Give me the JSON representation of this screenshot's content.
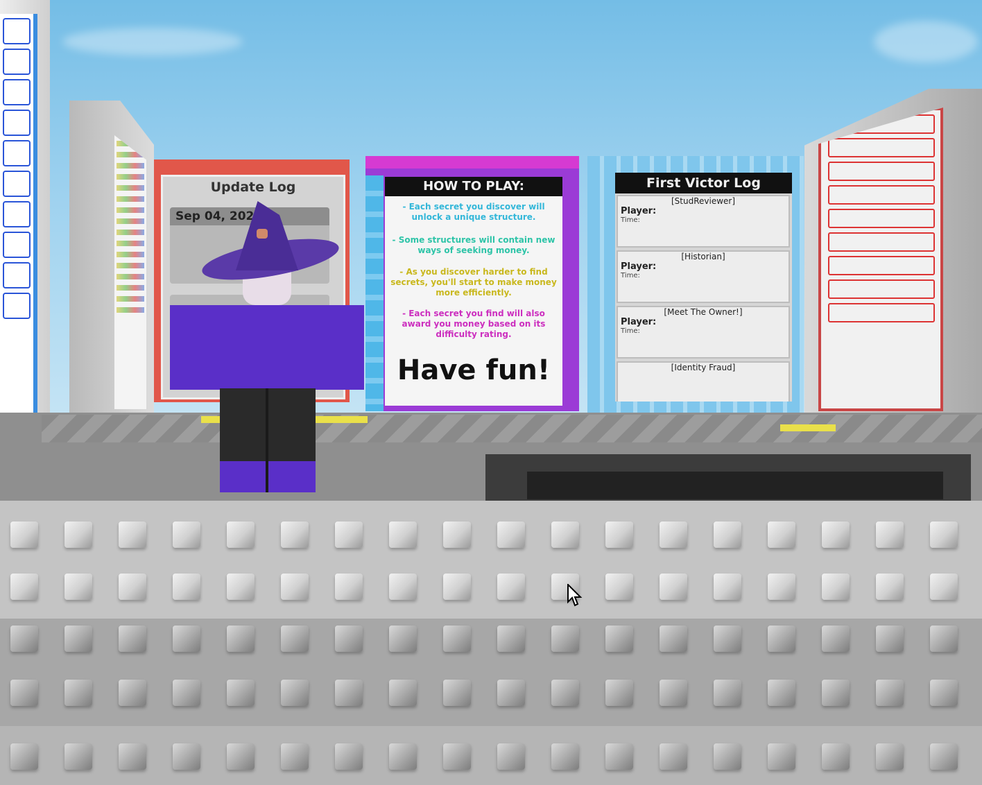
{
  "update_log": {
    "title": "Update Log",
    "date": "Sep 04, 2025"
  },
  "how_to_play": {
    "title": "HOW TO PLAY:",
    "rules": [
      {
        "text": "- Each secret you discover will unlock a unique structure.",
        "color": "#33b7d9"
      },
      {
        "text": "- Some structures will contain new ways of seeking money.",
        "color": "#2ec4a8"
      },
      {
        "text": "- As you discover harder to find secrets, you'll start to make money more efficiently.",
        "color": "#c9b81e"
      },
      {
        "text": "- Each secret you find will also award you money based on its difficulty rating.",
        "color": "#cc2fbf"
      }
    ],
    "closing": "Have fun!"
  },
  "first_victor_log": {
    "title": "First Victor Log",
    "records": [
      {
        "badge": "[StudReviewer]",
        "player_label": "Player:",
        "player": "",
        "time_label": "Time:"
      },
      {
        "badge": "[Historian]",
        "player_label": "Player:",
        "player": "",
        "time_label": "Time:"
      },
      {
        "badge": "[Meet The Owner!]",
        "player_label": "Player:",
        "player": "",
        "time_label": "Time:"
      },
      {
        "badge": "[Identity Fraud]",
        "player_label": "",
        "player": "",
        "time_label": ""
      }
    ]
  },
  "colors": {
    "update_board": "#e1574a",
    "how_board": "#9b3bd6",
    "victor_board": "#7fc6ec",
    "avatar_outfit": "#5a2fc8"
  }
}
